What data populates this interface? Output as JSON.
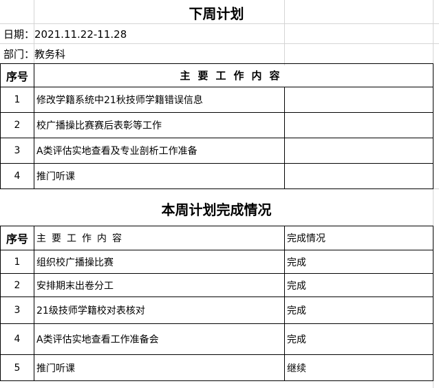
{
  "next_week": {
    "title": "下周计划",
    "date_line": "日期：2021.11.22-11.28",
    "dept_line": "部门：教务科",
    "col_num": "序号",
    "col_content": "主要工作内容",
    "rows": [
      {
        "num": "1",
        "content": "修改学籍系统中21秋技师学籍错误信息"
      },
      {
        "num": "2",
        "content": "校广播操比赛赛后表彰等工作"
      },
      {
        "num": "3",
        "content": "A类评估实地查看及专业剖析工作准备"
      },
      {
        "num": "4",
        "content": "推门听课"
      }
    ]
  },
  "this_week": {
    "title": "本周计划完成情况",
    "col_num": "序号",
    "col_content": "主要工作内容",
    "col_status": "完成情况",
    "rows": [
      {
        "num": "1",
        "content": "组织校广播操比赛",
        "status": "完成"
      },
      {
        "num": "2",
        "content": "安排期末出卷分工",
        "status": "完成"
      },
      {
        "num": "3",
        "content": "21级技师学籍校对表核对",
        "status": "完成"
      },
      {
        "num": "4",
        "content": "A类评估实地查看工作准备会",
        "status": "完成"
      },
      {
        "num": "5",
        "content": "推门听课",
        "status": "继续"
      }
    ]
  }
}
